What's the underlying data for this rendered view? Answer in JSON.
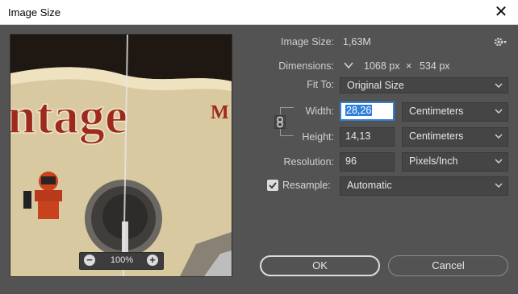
{
  "window": {
    "title": "Image Size",
    "close_label": "✕"
  },
  "preview": {
    "zoom": "100%",
    "zoom_minus": "−",
    "zoom_plus": "+",
    "artwork_text": "ntage",
    "artwork_text_small": "M"
  },
  "image_size": {
    "label": "Image Size:",
    "value": "1,63M"
  },
  "dimensions": {
    "label": "Dimensions:",
    "width": "1068 px",
    "times": "×",
    "height": "534 px"
  },
  "fit_to": {
    "label": "Fit To:",
    "value": "Original Size"
  },
  "width": {
    "label": "Width:",
    "value": "28,26",
    "unit": "Centimeters"
  },
  "height": {
    "label": "Height:",
    "value": "14,13",
    "unit": "Centimeters"
  },
  "resolution": {
    "label": "Resolution:",
    "value": "96",
    "unit": "Pixels/Inch"
  },
  "resample": {
    "label": "Resample:",
    "checked": true,
    "value": "Automatic"
  },
  "buttons": {
    "ok": "OK",
    "cancel": "Cancel"
  },
  "colors": {
    "background": "#535353",
    "field": "#454545",
    "accent": "#2f7ed8",
    "artwork_red": "#9e2a1e"
  }
}
